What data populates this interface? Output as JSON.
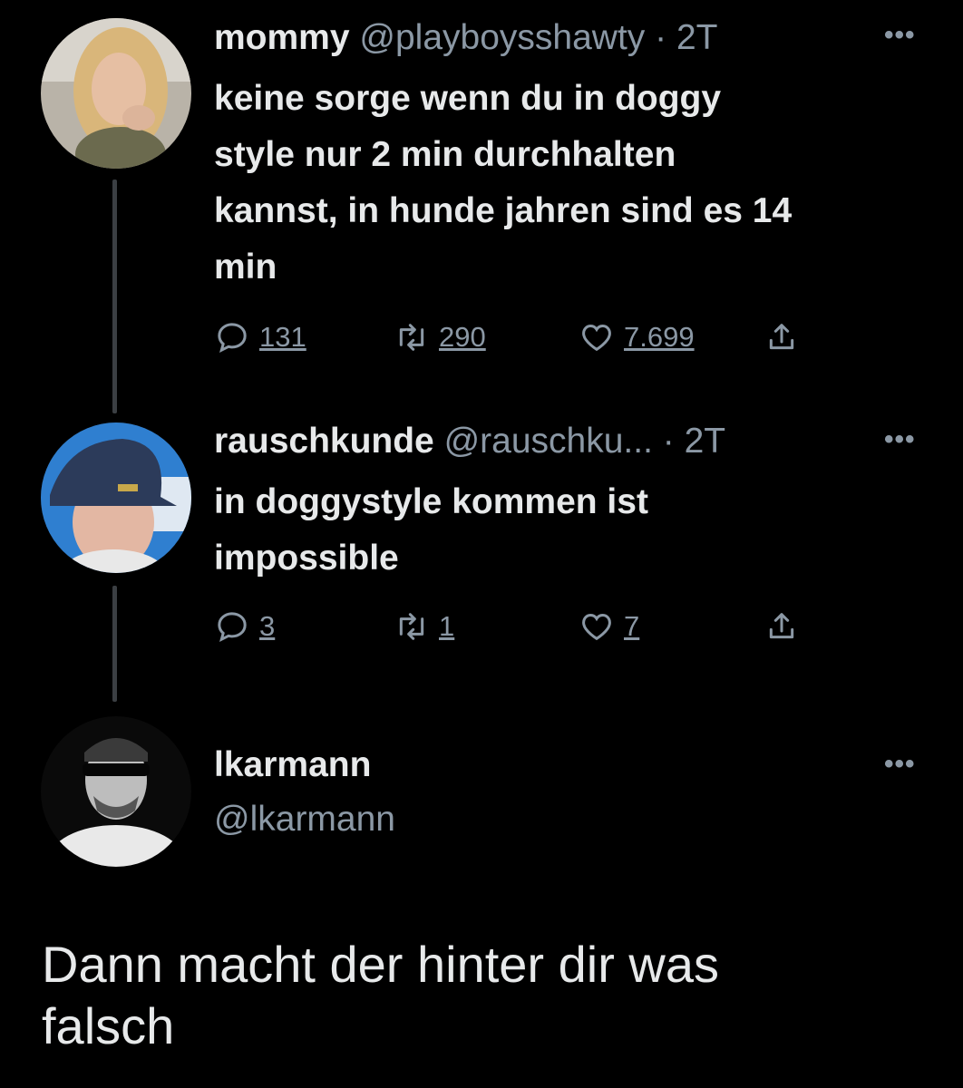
{
  "tweets": [
    {
      "name": "mommy",
      "handle": "@playboysshawty",
      "time": "· 2T",
      "text_lines": [
        "keine sorge wenn du in doggy",
        "style nur 2 min durchhalten",
        "kannst, in hunde jahren sind es 14",
        "min"
      ],
      "replies": "131",
      "retweets": "290",
      "likes": "7.699"
    },
    {
      "name": "rauschkunde",
      "handle": "@rauschku...",
      "time": "· 2T",
      "text_lines": [
        "in doggystyle kommen ist",
        "impossible"
      ],
      "replies": "3",
      "retweets": "1",
      "likes": "7"
    }
  ],
  "main_tweet": {
    "name": "lkarmann",
    "handle": "@lkarmann",
    "text_lines": [
      "Dann macht der hinter dir was",
      "falsch"
    ]
  },
  "icons": [
    "reply-icon",
    "retweet-icon",
    "like-icon",
    "share-icon",
    "more-icon"
  ],
  "colors": {
    "background": "#000000",
    "text": "#e7e9ea",
    "muted": "#8b98a5"
  }
}
